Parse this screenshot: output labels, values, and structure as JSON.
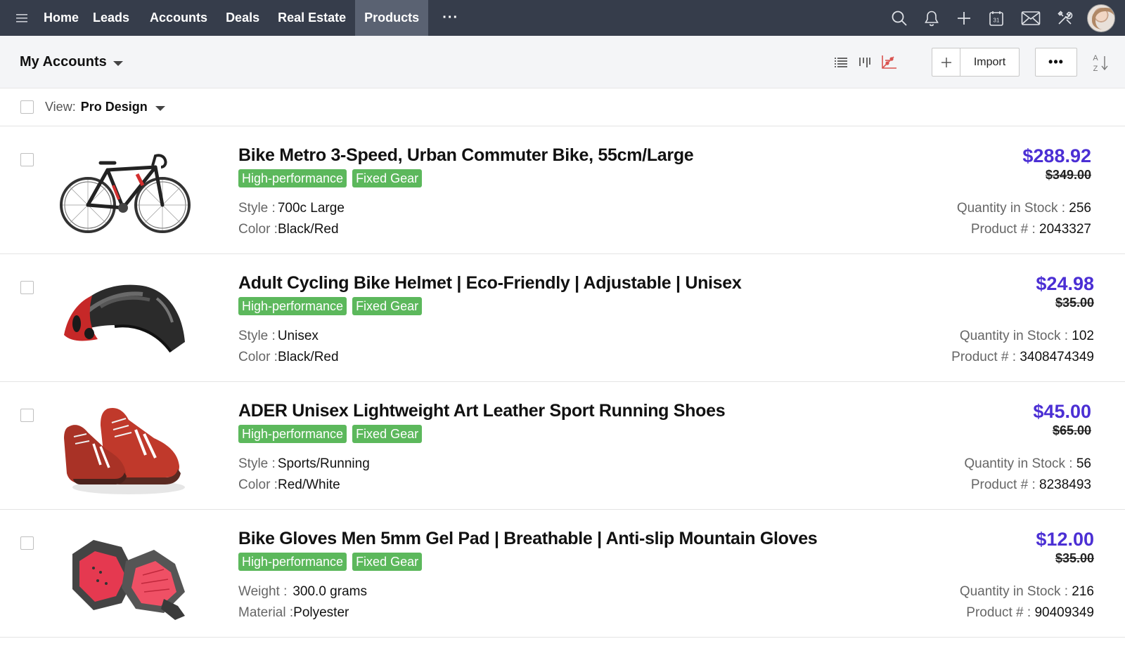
{
  "nav": {
    "items": [
      "Home",
      "Leads",
      "Accounts",
      "Deals",
      "Real Estate",
      "Products"
    ],
    "active_index": 5,
    "more_label": "···"
  },
  "icons": {
    "menu": "hamburger-menu-icon",
    "search": "search-icon",
    "bell": "bell-icon",
    "add": "plus-icon",
    "calendar": "calendar-icon",
    "calendar_day": "31",
    "mail": "mail-icon",
    "tools": "tools-icon",
    "list_view": "list-view-icon",
    "kanban_view": "kanban-view-icon",
    "chart_view": "chart-view-icon",
    "sort": "sort-az-icon"
  },
  "subheader": {
    "title": "My Accounts",
    "import_label": "Import",
    "more_label": "•••",
    "sort_top": "A",
    "sort_bottom": "Z"
  },
  "view": {
    "label": "View:",
    "value": "Pro Design"
  },
  "colors": {
    "topbar": "#363d4b",
    "active_tab": "#5a6272",
    "price": "#4b2fd4",
    "tag": "#5cb85c"
  },
  "products": [
    {
      "title": "Bike Metro 3-Speed, Urban Commuter Bike, 55cm/Large",
      "tags": [
        "High-performance",
        "Fixed Gear"
      ],
      "attrs": [
        {
          "key": "Style : ",
          "value": "700c Large"
        },
        {
          "key": "Color : ",
          "value": "Black/Red"
        }
      ],
      "price": "$288.92",
      "old_price": "$349.00",
      "meta": [
        {
          "key": "Quantity in Stock : ",
          "value": "256"
        },
        {
          "key": "Product # : ",
          "value": "2043327"
        }
      ],
      "image": "bicycle"
    },
    {
      "title": "Adult Cycling Bike Helmet | Eco-Friendly | Adjustable | Unisex",
      "tags": [
        "High-performance",
        "Fixed Gear"
      ],
      "attrs": [
        {
          "key": "Style : ",
          "value": "Unisex"
        },
        {
          "key": "Color : ",
          "value": "Black/Red"
        }
      ],
      "price": "$24.98",
      "old_price": "$35.00",
      "meta": [
        {
          "key": "Quantity in Stock : ",
          "value": "102"
        },
        {
          "key": "Product # : ",
          "value": "3408474349"
        }
      ],
      "image": "helmet"
    },
    {
      "title": "ADER Unisex Lightweight Art Leather Sport Running Shoes",
      "tags": [
        "High-performance",
        "Fixed Gear"
      ],
      "attrs": [
        {
          "key": "Style : ",
          "value": "Sports/Running"
        },
        {
          "key": "Color : ",
          "value": "Red/White"
        }
      ],
      "price": "$45.00",
      "old_price": "$65.00",
      "meta": [
        {
          "key": "Quantity in Stock : ",
          "value": "56"
        },
        {
          "key": "Product # : ",
          "value": "8238493"
        }
      ],
      "image": "shoes"
    },
    {
      "title": "Bike Gloves Men 5mm Gel Pad | Breathable | Anti-slip Mountain Gloves",
      "tags": [
        "High-performance",
        "Fixed Gear"
      ],
      "attrs": [
        {
          "key": "Weight : ",
          "value": "300.0 grams"
        },
        {
          "key": "Material : ",
          "value": "Polyester"
        }
      ],
      "price": "$12.00",
      "old_price": "$35.00",
      "meta": [
        {
          "key": "Quantity in Stock : ",
          "value": "216"
        },
        {
          "key": "Product # : ",
          "value": "90409349"
        }
      ],
      "image": "gloves"
    }
  ]
}
